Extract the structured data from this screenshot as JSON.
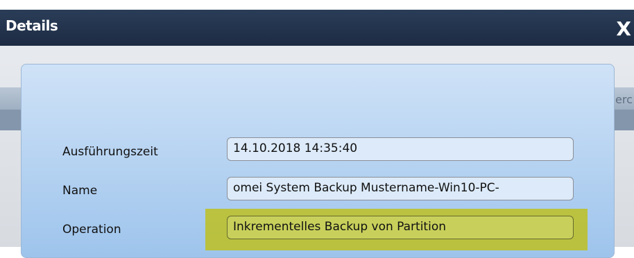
{
  "dialog": {
    "title": "Details",
    "close_label": "X"
  },
  "background": {
    "fragment_text": "erc"
  },
  "fields": {
    "execution_time": {
      "label": "Ausführungszeit",
      "value": "14.10.2018 14:35:40"
    },
    "name": {
      "label": "Name",
      "value": "omei System Backup Mustername-Win10-PC-"
    },
    "operation": {
      "label": "Operation",
      "value": "Inkrementelles Backup von Partition"
    }
  },
  "colors": {
    "header": "#22324b",
    "panel": "#b7d4f2",
    "highlight": "#bbc136"
  }
}
